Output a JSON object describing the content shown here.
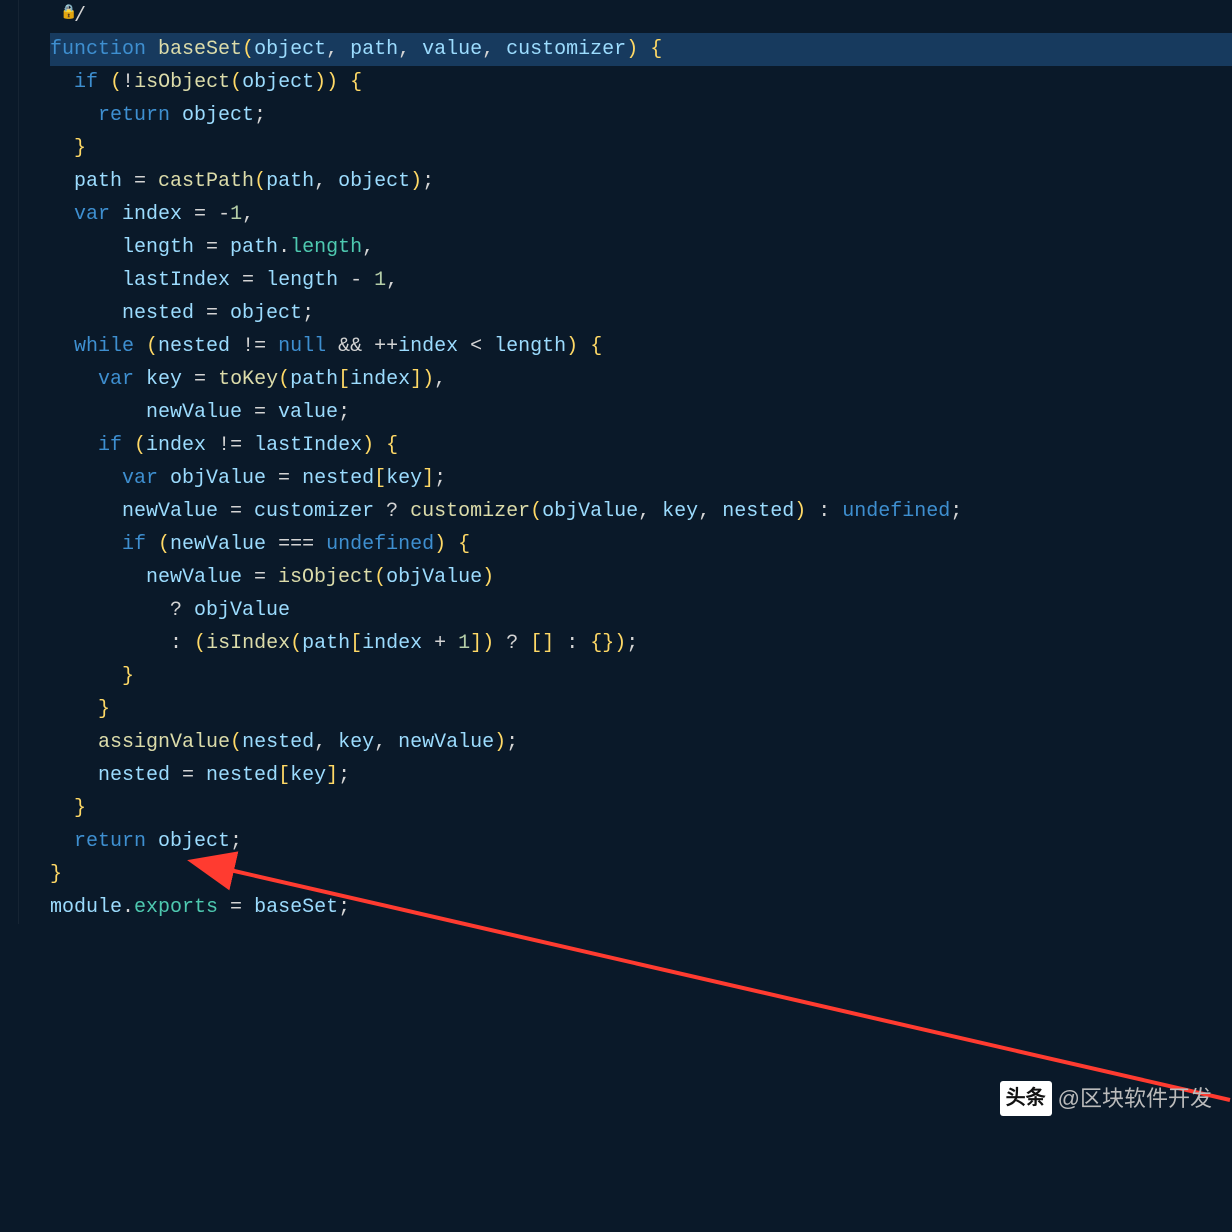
{
  "top_fragment": " */",
  "lock_glyph": "🔒",
  "code": {
    "l1": {
      "kw": "function ",
      "fn": "baseSet",
      "p": "(",
      "a1": "object",
      "c1": ", ",
      "a2": "path",
      "c2": ", ",
      "a3": "value",
      "c3": ", ",
      "a4": "customizer",
      "cp": ") ",
      "ob": "{"
    },
    "l2": {
      "pre": "  ",
      "kw": "if ",
      "p": "(",
      "not": "!",
      "fn": "isObject",
      "p2": "(",
      "arg": "object",
      "cp": "))",
      "sp": " ",
      "ob": "{"
    },
    "l3": {
      "pre": "    ",
      "kw": "return ",
      "id": "object",
      "sc": ";"
    },
    "l4": {
      "pre": "  ",
      "cb": "}"
    },
    "l5": {
      "pre": "  ",
      "id": "path",
      "eq": " = ",
      "fn": "castPath",
      "p": "(",
      "a1": "path",
      "c": ", ",
      "a2": "object",
      "cp": ")",
      "sc": ";"
    },
    "l6": {
      "pre": ""
    },
    "l7": {
      "pre": "  ",
      "kw": "var ",
      "id": "index",
      "eq": " = ",
      "m": "-",
      "n": "1",
      "c": ","
    },
    "l8": {
      "pre": "      ",
      "id": "length",
      "eq": " = ",
      "id2": "path",
      "dot": ".",
      "prop": "length",
      "c": ","
    },
    "l9": {
      "pre": "      ",
      "id": "lastIndex",
      "eq": " = ",
      "id2": "length",
      "m": " - ",
      "n": "1",
      "c": ","
    },
    "l10": {
      "pre": "      ",
      "id": "nested",
      "eq": " = ",
      "id2": "object",
      "sc": ";"
    },
    "l11": {
      "pre": ""
    },
    "l12": {
      "pre": "  ",
      "kw": "while ",
      "p": "(",
      "id": "nested",
      "ne": " != ",
      "null": "null",
      "and": " && ",
      "inc": "++",
      "id2": "index",
      "lt": " < ",
      "id3": "length",
      "cp": ") ",
      "ob": "{"
    },
    "l13": {
      "pre": "    ",
      "kw": "var ",
      "id": "key",
      "eq": " = ",
      "fn": "toKey",
      "p": "(",
      "id2": "path",
      "lb": "[",
      "id3": "index",
      "rb": "]",
      "cp": ")",
      "c": ","
    },
    "l14": {
      "pre": "        ",
      "id": "newValue",
      "eq": " = ",
      "id2": "value",
      "sc": ";"
    },
    "l15": {
      "pre": ""
    },
    "l16": {
      "pre": "    ",
      "kw": "if ",
      "p": "(",
      "id": "index",
      "ne": " != ",
      "id2": "lastIndex",
      "cp": ") ",
      "ob": "{"
    },
    "l17": {
      "pre": "      ",
      "kw": "var ",
      "id": "objValue",
      "eq": " = ",
      "id2": "nested",
      "lb": "[",
      "id3": "key",
      "rb": "]",
      "sc": ";"
    },
    "l18": {
      "pre": "      ",
      "id": "newValue",
      "eq": " = ",
      "id2": "customizer",
      "q": " ? ",
      "fn": "customizer",
      "p": "(",
      "a1": "objValue",
      "c1": ", ",
      "a2": "key",
      "c2": ", ",
      "a3": "nested",
      "cp": ")",
      "col": " : ",
      "undef": "undefined",
      "sc": ";"
    },
    "l19": {
      "pre": "      ",
      "kw": "if ",
      "p": "(",
      "id": "newValue",
      "eq3": " === ",
      "undef": "undefined",
      "cp": ") ",
      "ob": "{"
    },
    "l20": {
      "pre": "        ",
      "id": "newValue",
      "eq": " = ",
      "fn": "isObject",
      "p": "(",
      "a": "objValue",
      "cp": ")"
    },
    "l21": {
      "pre": "          ",
      "q": "? ",
      "id": "objValue"
    },
    "l22": {
      "pre": "          ",
      "col": ": ",
      "p": "(",
      "fn": "isIndex",
      "p2": "(",
      "id": "path",
      "lb": "[",
      "id2": "index",
      "plus": " + ",
      "n": "1",
      "rb": "]",
      "cp": ")",
      "q": " ? ",
      "arr": "[]",
      "col2": " : ",
      "obj": "{}",
      "cp2": ")",
      "sc": ";"
    },
    "l23": {
      "pre": "      ",
      "cb": "}"
    },
    "l24": {
      "pre": "    ",
      "cb": "}"
    },
    "l25": {
      "pre": "    ",
      "fn": "assignValue",
      "p": "(",
      "a1": "nested",
      "c1": ", ",
      "a2": "key",
      "c2": ", ",
      "a3": "newValue",
      "cp": ")",
      "sc": ";"
    },
    "l26": {
      "pre": "    ",
      "id": "nested",
      "eq": " = ",
      "id2": "nested",
      "lb": "[",
      "id3": "key",
      "rb": "]",
      "sc": ";"
    },
    "l27": {
      "pre": "  ",
      "cb": "}"
    },
    "l28": {
      "pre": "  ",
      "kw": "return ",
      "id": "object",
      "sc": ";"
    },
    "l29": {
      "cb": "}"
    },
    "l30": {
      "pre": ""
    },
    "l31": {
      "id": "module",
      "dot": ".",
      "prop": "exports",
      "eq": " = ",
      "id2": "baseSet",
      "sc": ";"
    }
  },
  "watermark": {
    "label": "头条",
    "handle": "@区块软件开发"
  }
}
